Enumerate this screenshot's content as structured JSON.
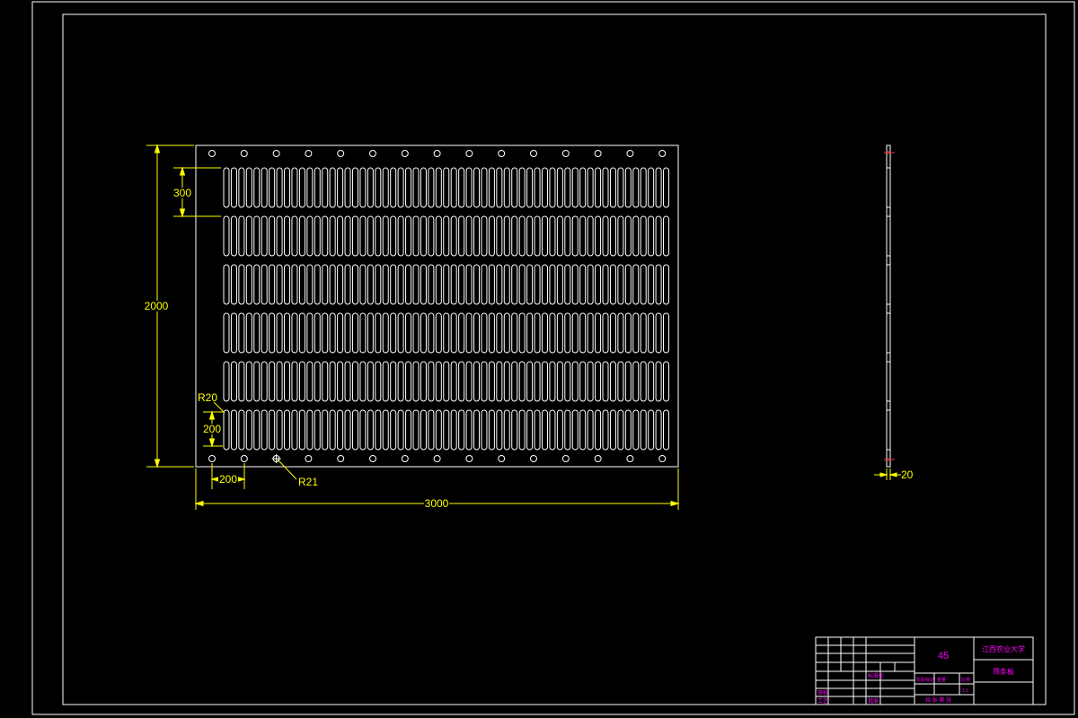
{
  "drawing": {
    "background": "#000000",
    "line_color": "#ffffff",
    "dimension_color": "#ffff00",
    "title_block_color": "#ff00ff",
    "hole_color": "#ff3333"
  },
  "dimensions": {
    "total_height": "2000",
    "total_width": "3000",
    "row_pitch": "300",
    "slot_length": "200",
    "hole_pitch": "200",
    "slot_radius": "R20",
    "hole_radius": "R21",
    "thickness": "20"
  },
  "plate": {
    "slot_rows": 6,
    "slots_per_row": 59,
    "holes_per_edge": 15
  },
  "title_block": {
    "material": "45",
    "university": "江西农业大学",
    "part_name": "筛条板",
    "label_standardize": "标准化",
    "label_review": "审核",
    "label_process": "工艺",
    "label_approve": "批准",
    "label_stage": "阶段标记",
    "label_weight": "重量",
    "label_scale": "比例",
    "scale_value": "1:1",
    "sheet_text": "共 张 第 张"
  }
}
